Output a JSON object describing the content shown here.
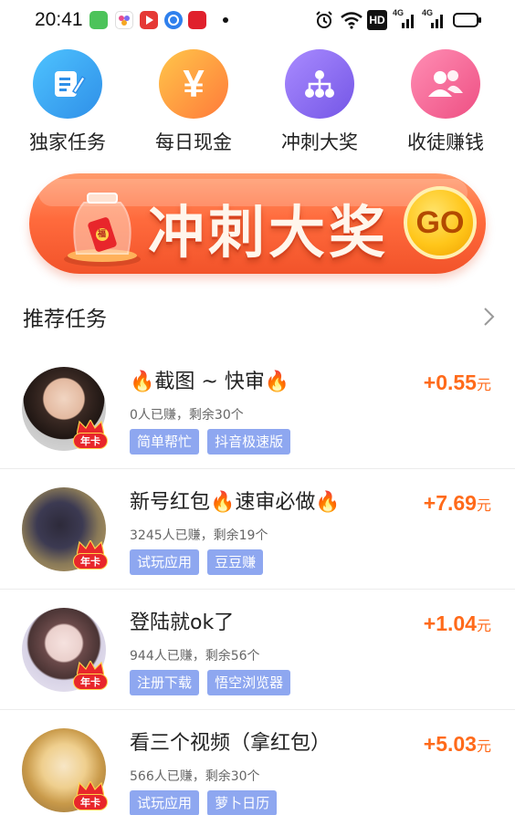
{
  "status_bar": {
    "time": "20:41",
    "network_1": "4G",
    "network_2": "4G",
    "hd": "HD"
  },
  "quick_actions": [
    {
      "label": "独家任务",
      "icon": "edit-note-icon",
      "color": "#3aa7ee"
    },
    {
      "label": "每日现金",
      "icon": "yen-icon",
      "color": "#ffa726"
    },
    {
      "label": "冲刺大奖",
      "icon": "hierarchy-icon",
      "color": "#8f6bf0"
    },
    {
      "label": "收徒赚钱",
      "icon": "users-icon",
      "color": "#f36b9a"
    }
  ],
  "banner": {
    "text": "冲刺大奖",
    "go": "GO",
    "jar_label": "福"
  },
  "section": {
    "title": "推荐任务"
  },
  "tasks": [
    {
      "title": "🔥截图 ~ 快审🔥",
      "sub": "0人已赚，剩余30个",
      "tags": [
        "简单帮忙",
        "抖音极速版"
      ],
      "amount": "+0.55",
      "unit": "元",
      "badge": "年卡"
    },
    {
      "title": "新号红包🔥速审必做🔥",
      "sub": "3245人已赚，剩余19个",
      "tags": [
        "试玩应用",
        "豆豆赚"
      ],
      "amount": "+7.69",
      "unit": "元",
      "badge": "年卡"
    },
    {
      "title": "登陆就ok了",
      "sub": "944人已赚，剩余56个",
      "tags": [
        "注册下载",
        "悟空浏览器"
      ],
      "amount": "+1.04",
      "unit": "元",
      "badge": "年卡"
    },
    {
      "title": "看三个视频（拿红包）",
      "sub": "566人已赚，剩余30个",
      "tags": [
        "试玩应用",
        "萝卜日历"
      ],
      "amount": "+5.03",
      "unit": "元",
      "badge": "年卡"
    }
  ]
}
